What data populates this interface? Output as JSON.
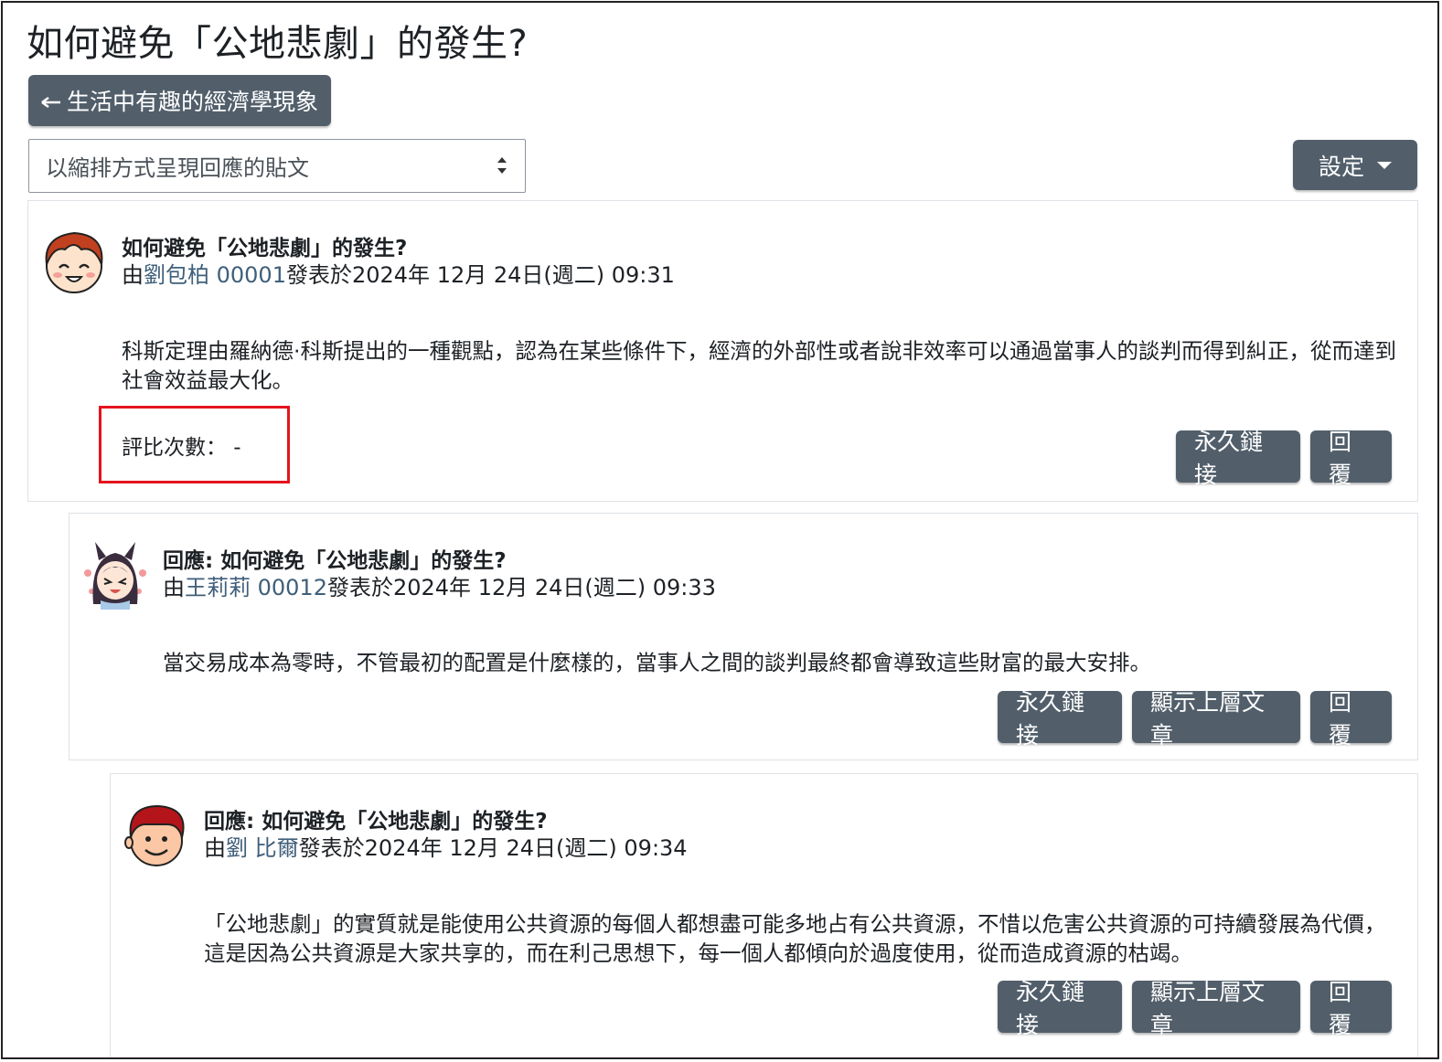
{
  "page": {
    "title": "如何避免「公地悲劇」的發生?",
    "back_button": "生活中有趣的經濟學現象",
    "display_mode": "以縮排方式呈現回應的貼文",
    "settings_button": "設定"
  },
  "posts": [
    {
      "subject": "如何避免「公地悲劇」的發生?",
      "by_prefix": "由",
      "author": "劉包柏 00001",
      "posted_text": "發表於2024年 12月 24日(週二) 09:31",
      "content": "科斯定理由羅納德·科斯提出的一種觀點，認為在某些條件下，經濟的外部性或者說非效率可以通過當事人的談判而得到糾正，從而達到社會效益最大化。",
      "rating_label": "評比次數： -",
      "buttons": {
        "permalink": "永久鏈接",
        "reply": "回覆"
      }
    },
    {
      "subject": "回應: 如何避免「公地悲劇」的發生?",
      "by_prefix": "由",
      "author": "王莉莉 00012",
      "posted_text": "發表於2024年 12月 24日(週二) 09:33",
      "content": "當交易成本為零時，不管最初的配置是什麼樣的，當事人之間的談判最終都會導致這些財富的最大安排。",
      "buttons": {
        "permalink": "永久鏈接",
        "show_parent": "顯示上層文章",
        "reply": "回覆"
      }
    },
    {
      "subject": "回應: 如何避免「公地悲劇」的發生?",
      "by_prefix": "由",
      "author": "劉 比爾",
      "posted_text": "發表於2024年 12月 24日(週二) 09:34",
      "content": "「公地悲劇」的實質就是能使用公共資源的每個人都想盡可能多地占有公共資源，不惜以危害公共資源的可持續發展為代價，這是因為公共資源是大家共享的，而在利己思想下，每一個人都傾向於過度使用，從而造成資源的枯竭。",
      "buttons": {
        "permalink": "永久鏈接",
        "show_parent": "顯示上層文章",
        "reply": "回覆"
      }
    }
  ],
  "colors": {
    "button_bg": "#525f6b",
    "author_link": "#3f5f7a",
    "highlight": "#e4141e"
  }
}
